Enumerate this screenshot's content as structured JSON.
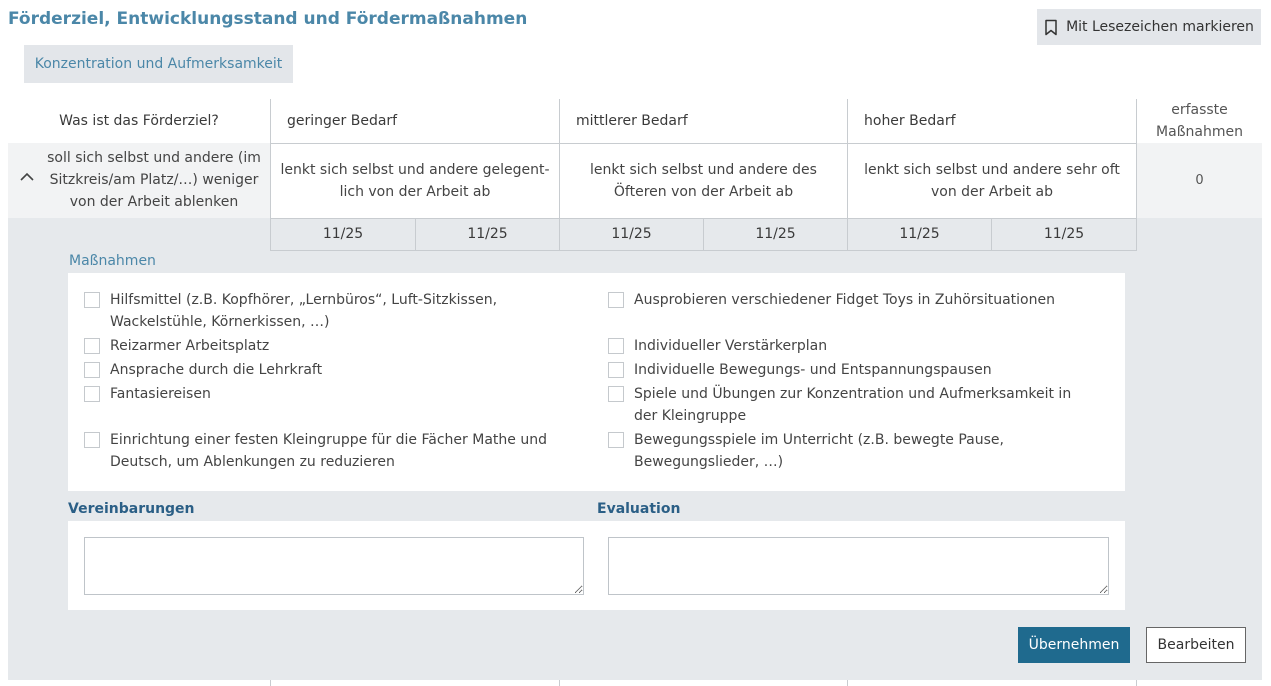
{
  "header": {
    "title": "Förderziel, Entwicklungsstand und Fördermaßnahmen",
    "bookmark_label": "Mit Lesezeichen markieren",
    "bookmark_icon": "bookmark-icon"
  },
  "topic_tab": "Konzentration und Aufmerksamkeit",
  "table": {
    "goal_header": "Was ist das Förderziel?",
    "levels": [
      "geringer Bedarf",
      "mittlerer Bedarf",
      "hoher Bedarf"
    ],
    "count_header": "erfasste Maßnahmen",
    "row": {
      "goal": "soll sich selbst und andere (im Sitzkreis/am Platz/…) weniger von der Arbeit ablenken",
      "descriptions": [
        "lenkt sich selbst und andere gelegent-lich von der Arbeit ab",
        "lenkt sich selbst und andere des Öfteren von der Arbeit ab",
        "lenkt sich selbst und andere sehr oft von der Arbeit ab"
      ],
      "count": "0",
      "dates": [
        "11/25",
        "11/25",
        "11/25",
        "11/25",
        "11/25",
        "11/25"
      ]
    }
  },
  "measures": {
    "title": "Maßnahmen",
    "left": [
      "Hilfsmittel (z.B. Kopfhörer, „Lernbüros“, Luft-Sitzkissen, Wackelstühle, Körnerkissen, …)",
      "Reizarmer Arbeitsplatz",
      "Ansprache durch die Lehrkraft",
      "Fantasiereisen",
      "Einrichtung einer festen Kleingruppe für die Fächer Mathe und Deutsch, um Ablenkungen zu reduzieren"
    ],
    "right": [
      "Ausprobieren verschiedener Fidget Toys in Zuhörsituationen",
      "Individueller Verstärkerplan",
      "Individuelle Bewegungs- und Entspannungspausen",
      "Spiele und Übungen zur Konzentration und Aufmerksamkeit in der Kleingruppe",
      "Bewegungsspiele im Unterricht (z.B. bewegte Pause, Bewegungslieder, …)"
    ]
  },
  "agreements": {
    "label": "Vereinbarungen",
    "value": ""
  },
  "evaluation": {
    "label": "Evaluation",
    "value": ""
  },
  "actions": {
    "apply": "Übernehmen",
    "edit": "Bearbeiten"
  },
  "colors": {
    "accent": "#4b87a8",
    "primary_button": "#1f6a8e",
    "panel": "#e6e9ec"
  }
}
